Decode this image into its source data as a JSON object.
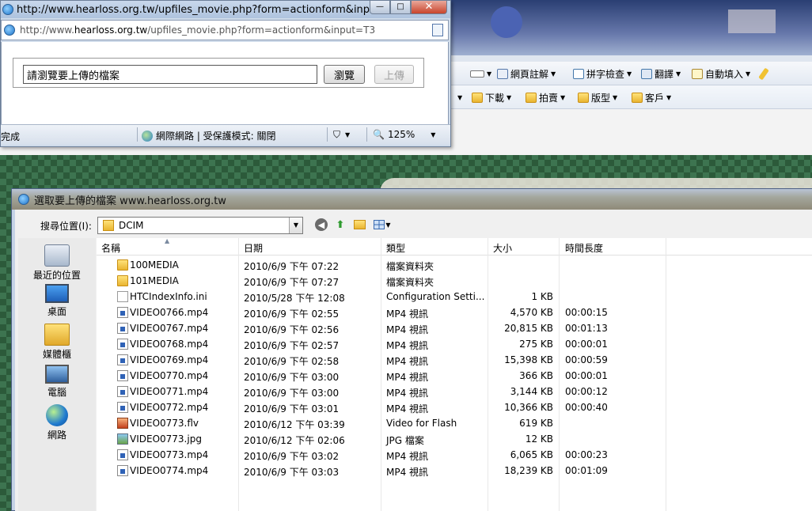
{
  "popup": {
    "title": "http://www.hearloss.org.tw/upfiles_movie.php?form=actionform&input=T3 ...",
    "url_prefix": "http://www.",
    "url_domain": "hearloss.org.tw",
    "url_suffix": "/upfiles_movie.php?form=actionform&input=T3",
    "file_input_value": "請瀏覽要上傳的檔案",
    "browse_label": "瀏覽",
    "upload_label": "上傳",
    "status_done": "完成",
    "status_zone": "網際網路 | 受保護模式: 關閉",
    "zoom": "125%",
    "close_glyph": "✕",
    "min_glyph": "—",
    "max_glyph": "□"
  },
  "bg": {
    "cmd": [
      "網頁註解",
      "拼字檢查",
      "翻譯",
      "自動填入"
    ],
    "fav": [
      "下載",
      "拍賣",
      "版型",
      "客戶"
    ]
  },
  "dialog": {
    "title": "選取要上傳的檔案 www.hearloss.org.tw",
    "lookin_label": "搜尋位置(I):",
    "lookin_value": "DCIM",
    "places": [
      "最近的位置",
      "桌面",
      "媒體櫃",
      "電腦",
      "網路"
    ],
    "columns": [
      "名稱",
      "日期",
      "類型",
      "大小",
      "時間長度"
    ],
    "files": [
      {
        "name": "100MEDIA",
        "date": "2010/6/9 下午 07:22",
        "type": "檔案資料夾",
        "size": "",
        "duration": "",
        "icon": "folder"
      },
      {
        "name": "101MEDIA",
        "date": "2010/6/9 下午 07:27",
        "type": "檔案資料夾",
        "size": "",
        "duration": "",
        "icon": "folder"
      },
      {
        "name": "HTCIndexInfo.ini",
        "date": "2010/5/28 下午 12:08",
        "type": "Configuration Setti...",
        "size": "1 KB",
        "duration": "",
        "icon": "ini"
      },
      {
        "name": "VIDEO0766.mp4",
        "date": "2010/6/9 下午 02:55",
        "type": "MP4 視訊",
        "size": "4,570 KB",
        "duration": "00:00:15",
        "icon": "mp4"
      },
      {
        "name": "VIDEO0767.mp4",
        "date": "2010/6/9 下午 02:56",
        "type": "MP4 視訊",
        "size": "20,815 KB",
        "duration": "00:01:13",
        "icon": "mp4"
      },
      {
        "name": "VIDEO0768.mp4",
        "date": "2010/6/9 下午 02:57",
        "type": "MP4 視訊",
        "size": "275 KB",
        "duration": "00:00:01",
        "icon": "mp4"
      },
      {
        "name": "VIDEO0769.mp4",
        "date": "2010/6/9 下午 02:58",
        "type": "MP4 視訊",
        "size": "15,398 KB",
        "duration": "00:00:59",
        "icon": "mp4"
      },
      {
        "name": "VIDEO0770.mp4",
        "date": "2010/6/9 下午 03:00",
        "type": "MP4 視訊",
        "size": "366 KB",
        "duration": "00:00:01",
        "icon": "mp4"
      },
      {
        "name": "VIDEO0771.mp4",
        "date": "2010/6/9 下午 03:00",
        "type": "MP4 視訊",
        "size": "3,144 KB",
        "duration": "00:00:12",
        "icon": "mp4"
      },
      {
        "name": "VIDEO0772.mp4",
        "date": "2010/6/9 下午 03:01",
        "type": "MP4 視訊",
        "size": "10,366 KB",
        "duration": "00:00:40",
        "icon": "mp4"
      },
      {
        "name": "VIDEO0773.flv",
        "date": "2010/6/12 下午 03:39",
        "type": "Video for Flash",
        "size": "619 KB",
        "duration": "",
        "icon": "flv"
      },
      {
        "name": "VIDEO0773.jpg",
        "date": "2010/6/12 下午 02:06",
        "type": "JPG 檔案",
        "size": "12 KB",
        "duration": "",
        "icon": "jpg"
      },
      {
        "name": "VIDEO0773.mp4",
        "date": "2010/6/9 下午 03:02",
        "type": "MP4 視訊",
        "size": "6,065 KB",
        "duration": "00:00:23",
        "icon": "mp4"
      },
      {
        "name": "VIDEO0774.mp4",
        "date": "2010/6/9 下午 03:03",
        "type": "MP4 視訊",
        "size": "18,239 KB",
        "duration": "00:01:09",
        "icon": "mp4"
      }
    ]
  }
}
